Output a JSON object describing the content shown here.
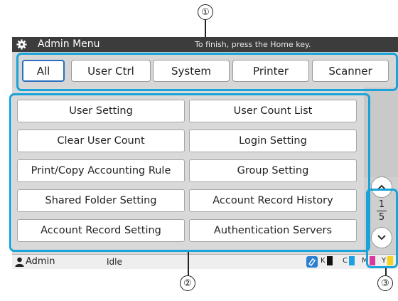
{
  "callouts": [
    "①",
    "②",
    "③"
  ],
  "titlebar": {
    "icon": "gear-icon",
    "title": "Admin Menu",
    "hint": "To finish, press the Home key."
  },
  "tabs": [
    {
      "label": "All",
      "active": true
    },
    {
      "label": "User Ctrl",
      "active": false
    },
    {
      "label": "System",
      "active": false
    },
    {
      "label": "Printer",
      "active": false
    },
    {
      "label": "Scanner",
      "active": false
    }
  ],
  "menu_buttons": [
    "User Setting",
    "User Count List",
    "Clear User Count",
    "Login Setting",
    "Print/Copy Accounting Rule",
    "Group Setting",
    "Shared Folder Setting",
    "Account Record History",
    "Account Record Setting",
    "Authentication Servers"
  ],
  "pager": {
    "current": "1",
    "total": "5",
    "up_icon": "chevron-up-icon",
    "down_icon": "chevron-down-icon"
  },
  "status_bar": {
    "user": "Admin",
    "user_icon": "person-icon",
    "state": "Idle",
    "ink_icon": "ink-status-icon",
    "inks": [
      {
        "label": "K",
        "color": "#111111"
      },
      {
        "label": "C",
        "color": "#1e9fe0"
      },
      {
        "label": "M",
        "color": "#d6399a"
      },
      {
        "label": "Y",
        "color": "#f3d21a"
      }
    ]
  },
  "colors": {
    "highlight": "#1aa3d9",
    "active_tab_border": "#2a6fbf",
    "titlebar_bg": "#3c3c3c"
  }
}
